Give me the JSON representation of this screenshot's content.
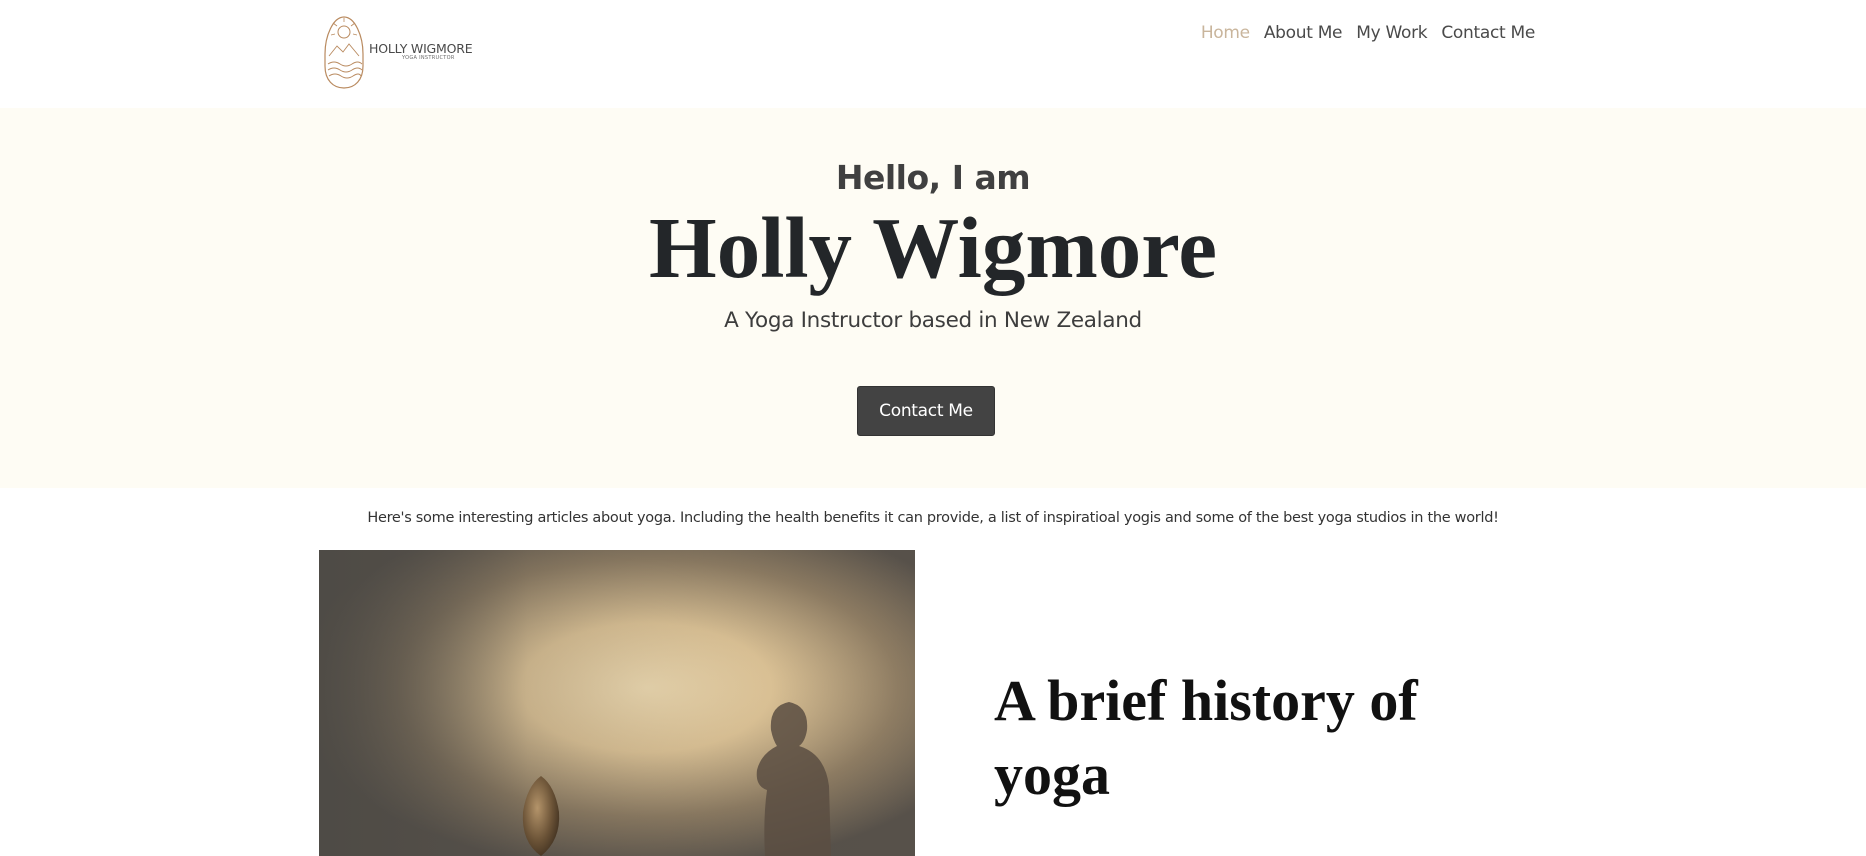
{
  "logo": {
    "name": "HOLLY WIGMORE",
    "subtitle": "YOGA INSTRUCTOR",
    "icon": "logo-arch-sun-waves"
  },
  "nav": {
    "items": [
      {
        "label": "Home",
        "active": true
      },
      {
        "label": "About Me",
        "active": false
      },
      {
        "label": "My Work",
        "active": false
      },
      {
        "label": "Contact Me",
        "active": false
      }
    ]
  },
  "hero": {
    "greeting": "Hello, I am",
    "name": "Holly Wigmore",
    "tagline": "A Yoga Instructor based in New Zealand",
    "button_label": "Contact Me"
  },
  "intro": {
    "text": "Here's some interesting articles about yoga. Including the health benefits it can provide, a list of inspiratioal yogis and some of the best yoga studios in the world!"
  },
  "article": {
    "title": "A brief history of yoga"
  },
  "colors": {
    "hero_background": "#fefcf4",
    "accent_active": "#c9b59c",
    "button_background": "#434343",
    "text_dark": "#232629"
  }
}
